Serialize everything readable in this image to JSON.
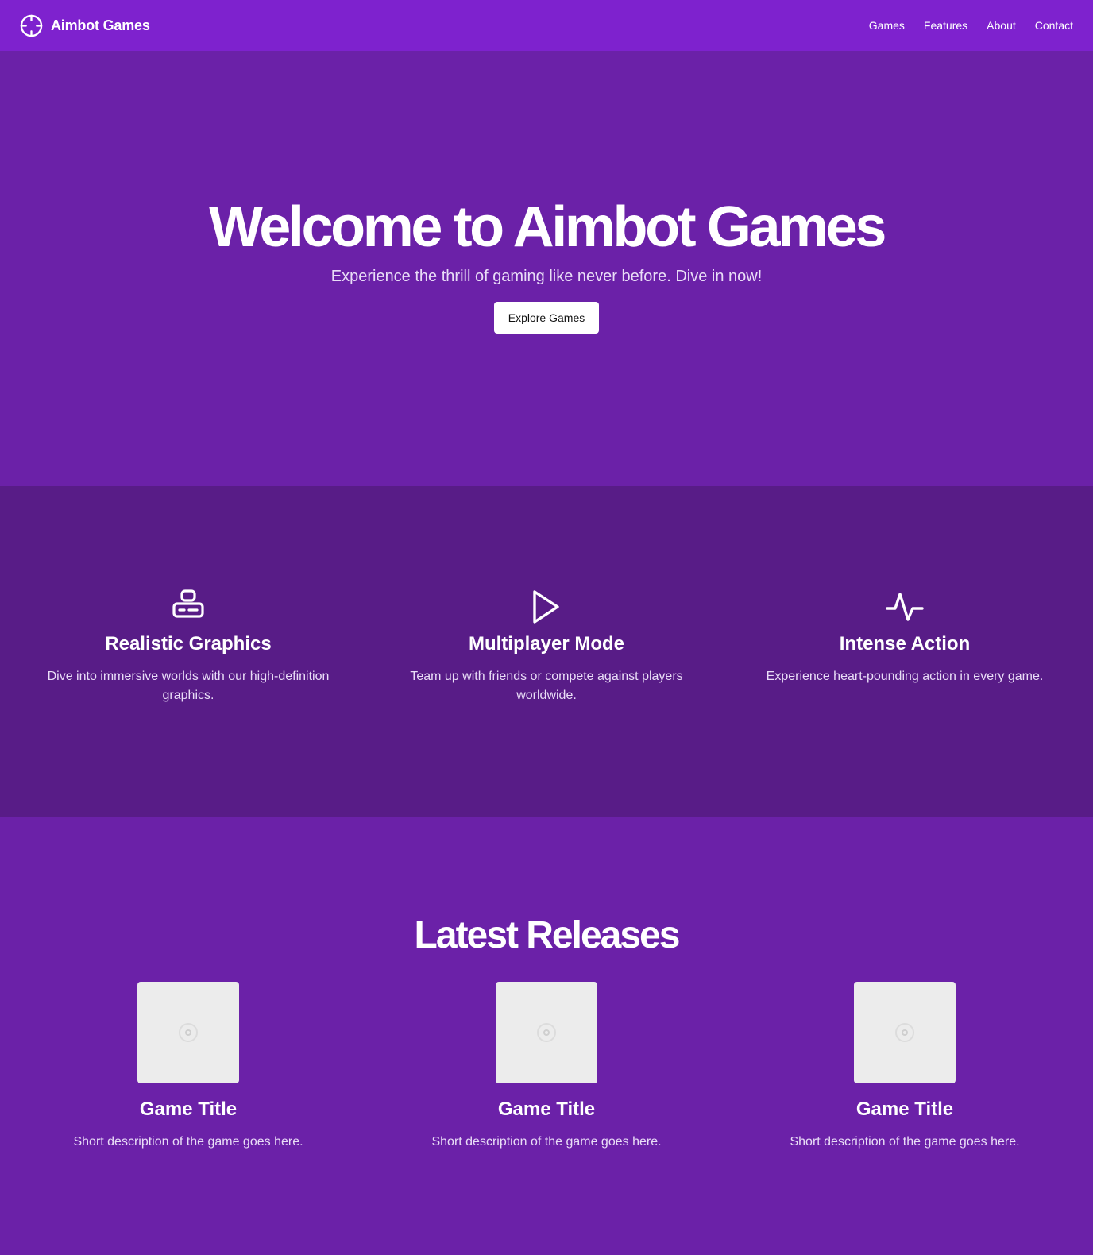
{
  "header": {
    "brand_name": "Aimbot Games",
    "brand_icon": "crosshair-icon",
    "nav": [
      "Games",
      "Features",
      "About",
      "Contact"
    ]
  },
  "hero": {
    "title": "Welcome to Aimbot Games",
    "subtitle": "Experience the thrill of gaming like never before. Dive in now!",
    "cta_label": "Explore Games"
  },
  "features": [
    {
      "icon": "gamepad-icon",
      "title": "Realistic Graphics",
      "description": "Dive into immersive worlds with our high-definition graphics."
    },
    {
      "icon": "play-icon",
      "title": "Multiplayer Mode",
      "description": "Team up with friends or compete against players worldwide."
    },
    {
      "icon": "activity-icon",
      "title": "Intense Action",
      "description": "Experience heart-pounding action in every game."
    }
  ],
  "releases": {
    "title": "Latest Releases",
    "games": [
      {
        "title": "Game Title",
        "description": "Short description of the game goes here."
      },
      {
        "title": "Game Title",
        "description": "Short description of the game goes here."
      },
      {
        "title": "Game Title",
        "description": "Short description of the game goes here."
      }
    ]
  },
  "colors": {
    "header_bg": "#7e22ce",
    "hero_bg": "#6b21a8",
    "features_bg": "#581c87",
    "text": "#ffffff",
    "muted_text": "#e9ddf7",
    "cta_bg": "#ffffff",
    "thumb_bg": "#ececec"
  }
}
